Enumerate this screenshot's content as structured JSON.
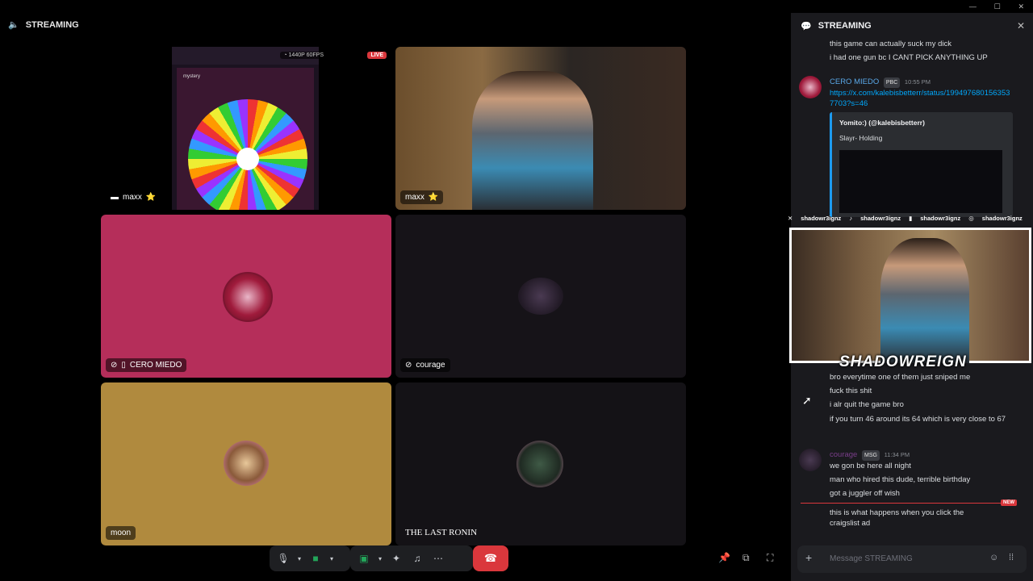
{
  "window": {
    "title": "STREAMING"
  },
  "stage": {
    "tiles": [
      {
        "name": "maxx",
        "badge": "⭐",
        "overlay_quality": "1440P 60FPS",
        "overlay_live": "LIVE",
        "screen_title": "mystery"
      },
      {
        "name": "maxx",
        "badge": "⭐"
      },
      {
        "name": "CERO MIEDO",
        "bg": "#b52e5a"
      },
      {
        "name": "courage",
        "bg": "#161318"
      },
      {
        "name": "moon",
        "bg": "#b08a3e"
      },
      {
        "name": "THE LAST RONIN",
        "bg": "#141216"
      }
    ]
  },
  "controls": {
    "mic_icon": "microphone-icon",
    "camera_icon": "camera-icon",
    "share_icon": "screen-share-icon",
    "activities_icon": "activities-icon",
    "soundboard_icon": "soundboard-icon",
    "more_icon": "more-icon",
    "end_call_icon": "end-call-icon",
    "pin_icon": "pin-icon",
    "popout_icon": "popout-icon",
    "fullscreen_icon": "fullscreen-icon",
    "accent_green": "#23a55a",
    "danger_red": "#da373c"
  },
  "chat": {
    "title": "STREAMING",
    "lines_top": [
      "this game can actually suck my dick",
      "i had one gun bc I CANT PICK ANYTHING UP"
    ],
    "msg_cero": {
      "author": "CERO MIEDO",
      "badge": "PBC",
      "time": "10:55 PM",
      "link": "https://x.com/kalebisbetterr/status/1994976801563537703?s=46",
      "embed_author": "Yomito:) (@kalebisbetterr)",
      "embed_text": "Slayr- Holding"
    },
    "lines_mid": [
      "bro everytime one of them just sniped me",
      "fuck this shit",
      "i alr quit the game bro",
      "if you turn 46 around its 64 which is very close to 67"
    ],
    "msg_courage": {
      "author": "courage",
      "badge": "MSG",
      "time": "11:34 PM",
      "lines": [
        "we gon be here all night",
        "man who hired this dude, terrible birthday",
        "got a juggler off wish"
      ]
    },
    "new_label": "NEW",
    "last_line": "this is what happens when you click the craigslist ad",
    "composer_placeholder": "Message STREAMING"
  },
  "overlay": {
    "socials": [
      "shadowr3ignz",
      "shadowr3ignz",
      "shadowr3ignz",
      "shadowr3ignz"
    ],
    "brand": "SHADOWREIGN"
  }
}
